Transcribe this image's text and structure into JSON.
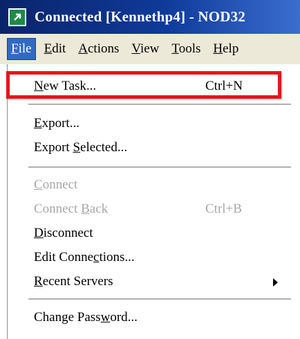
{
  "window": {
    "title": "Connected [Kennethp4] - NOD32",
    "icon": "arrow-up-right-icon"
  },
  "menubar": [
    {
      "label": "File",
      "accel": "F",
      "rest": "ile",
      "active": true
    },
    {
      "label": "Edit",
      "accel": "E",
      "rest": "dit"
    },
    {
      "label": "Actions",
      "accel": "A",
      "rest": "ctions"
    },
    {
      "label": "View",
      "accel": "V",
      "rest": "iew"
    },
    {
      "label": "Tools",
      "accel": "T",
      "rest": "ools"
    },
    {
      "label": "Help",
      "accel": "H",
      "rest": "elp"
    }
  ],
  "file_menu": {
    "new_task": {
      "pre": "",
      "u": "N",
      "post": "ew Task...",
      "shortcut": "Ctrl+N"
    },
    "export": {
      "pre": "",
      "u": "E",
      "post": "xport..."
    },
    "export_selected": {
      "pre": "Export ",
      "u": "S",
      "post": "elected..."
    },
    "connect": {
      "pre": "",
      "u": "C",
      "post": "onnect",
      "disabled": true
    },
    "connect_back": {
      "pre": "Connect ",
      "u": "B",
      "post": "ack",
      "shortcut": "Ctrl+B",
      "disabled": true
    },
    "disconnect": {
      "pre": "",
      "u": "D",
      "post": "isconnect"
    },
    "edit_connections": {
      "pre": "Edit Conne",
      "u": "c",
      "post": "tions..."
    },
    "recent_servers": {
      "pre": "",
      "u": "R",
      "post": "ecent Servers",
      "submenu": true
    },
    "change_password": {
      "pre": "Change Pass",
      "u": "w",
      "post": "ord..."
    }
  },
  "colors": {
    "titlebar": "#0a246a",
    "menu_highlight": "#316ac5",
    "annotation_box": "#e8141b",
    "disabled_text": "#a7a7a7"
  }
}
